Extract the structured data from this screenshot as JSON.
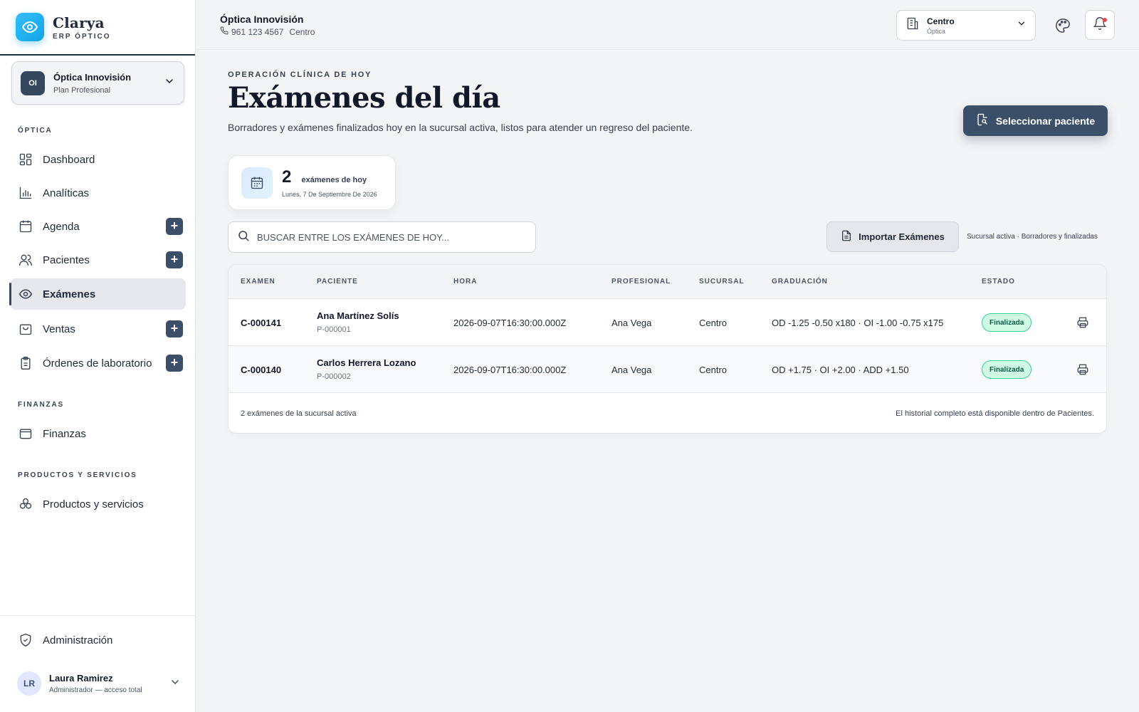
{
  "brand": {
    "name": "Clarya",
    "subtitle": "ERP ÓPTICO"
  },
  "organization": {
    "initials": "OI",
    "name": "Óptica Innovisión",
    "plan": "Plan Profesional"
  },
  "sidebar": {
    "sections": {
      "optica": "ÓPTICA",
      "finanzas": "FINANZAS",
      "productos": "PRODUCTOS Y SERVICIOS"
    },
    "items": [
      {
        "label": "Dashboard",
        "icon": "dashboard-icon"
      },
      {
        "label": "Analíticas",
        "icon": "bar-chart-icon"
      },
      {
        "label": "Agenda",
        "icon": "calendar-icon",
        "plus": true
      },
      {
        "label": "Pacientes",
        "icon": "users-icon",
        "plus": true
      },
      {
        "label": "Exámenes",
        "icon": "eye-icon",
        "active": true
      },
      {
        "label": "Ventas",
        "icon": "shopping-bag-icon",
        "plus": true
      },
      {
        "label": "Órdenes de laboratorio",
        "icon": "clipboard-icon",
        "plus": true
      },
      {
        "label": "Finanzas",
        "icon": "wallet-icon"
      },
      {
        "label": "Productos y servicios",
        "icon": "boxes-icon"
      },
      {
        "label": "Administración",
        "icon": "shield-icon"
      }
    ],
    "plus_symbol": "+"
  },
  "user": {
    "initials": "LR",
    "name": "Laura Ramirez",
    "role": "Administrador — acceso total"
  },
  "topbar": {
    "title": "Óptica Innovisión",
    "phone": "961 123 4567",
    "location": "Centro",
    "branch_name": "Centro",
    "branch_type": "Óptica"
  },
  "page": {
    "eyebrow": "OPERACIÓN CLÍNICA DE HOY",
    "title": "Exámenes del día",
    "description": "Borradores y exámenes finalizados hoy en la sucursal activa, listos para atender un regreso del paciente.",
    "select_patient_label": "Seleccionar paciente"
  },
  "stats": {
    "count": "2",
    "label": "exámenes de hoy",
    "date": "Lunes, 7 De Septiembre De 2026"
  },
  "search": {
    "placeholder": "BUSCAR ENTRE LOS EXÁMENES DE HOY...",
    "value": ""
  },
  "import_label": "Importar Exámenes",
  "filter_note": "Sucursal activa · Borradores y finalizadas",
  "table": {
    "headers": [
      "EXAMEN",
      "PACIENTE",
      "HORA",
      "PROFESIONAL",
      "SUCURSAL",
      "GRADUACIÓN",
      "ESTADO"
    ],
    "rows": [
      {
        "code": "C-000141",
        "patient": "Ana Martínez Solís",
        "patient_id": "P-000001",
        "time": "2026-09-07T16:30:00.000Z",
        "professional": "Ana Vega",
        "branch": "Centro",
        "graduation": "OD -1.25 -0.50 x180 · OI -1.00 -0.75 x175",
        "status": "Finalizada"
      },
      {
        "code": "C-000140",
        "patient": "Carlos Herrera Lozano",
        "patient_id": "P-000002",
        "time": "2026-09-07T16:30:00.000Z",
        "professional": "Ana Vega",
        "branch": "Centro",
        "graduation": "OD +1.75 · OI +2.00 · ADD +1.50",
        "status": "Finalizada"
      }
    ],
    "footer_left": "2 exámenes de la sucursal activa",
    "footer_right": "El historial completo está disponible dentro de Pacientes."
  },
  "colors": {
    "accent": "#3b5068",
    "brand": "#0ea5e9",
    "success": "#34d399"
  }
}
